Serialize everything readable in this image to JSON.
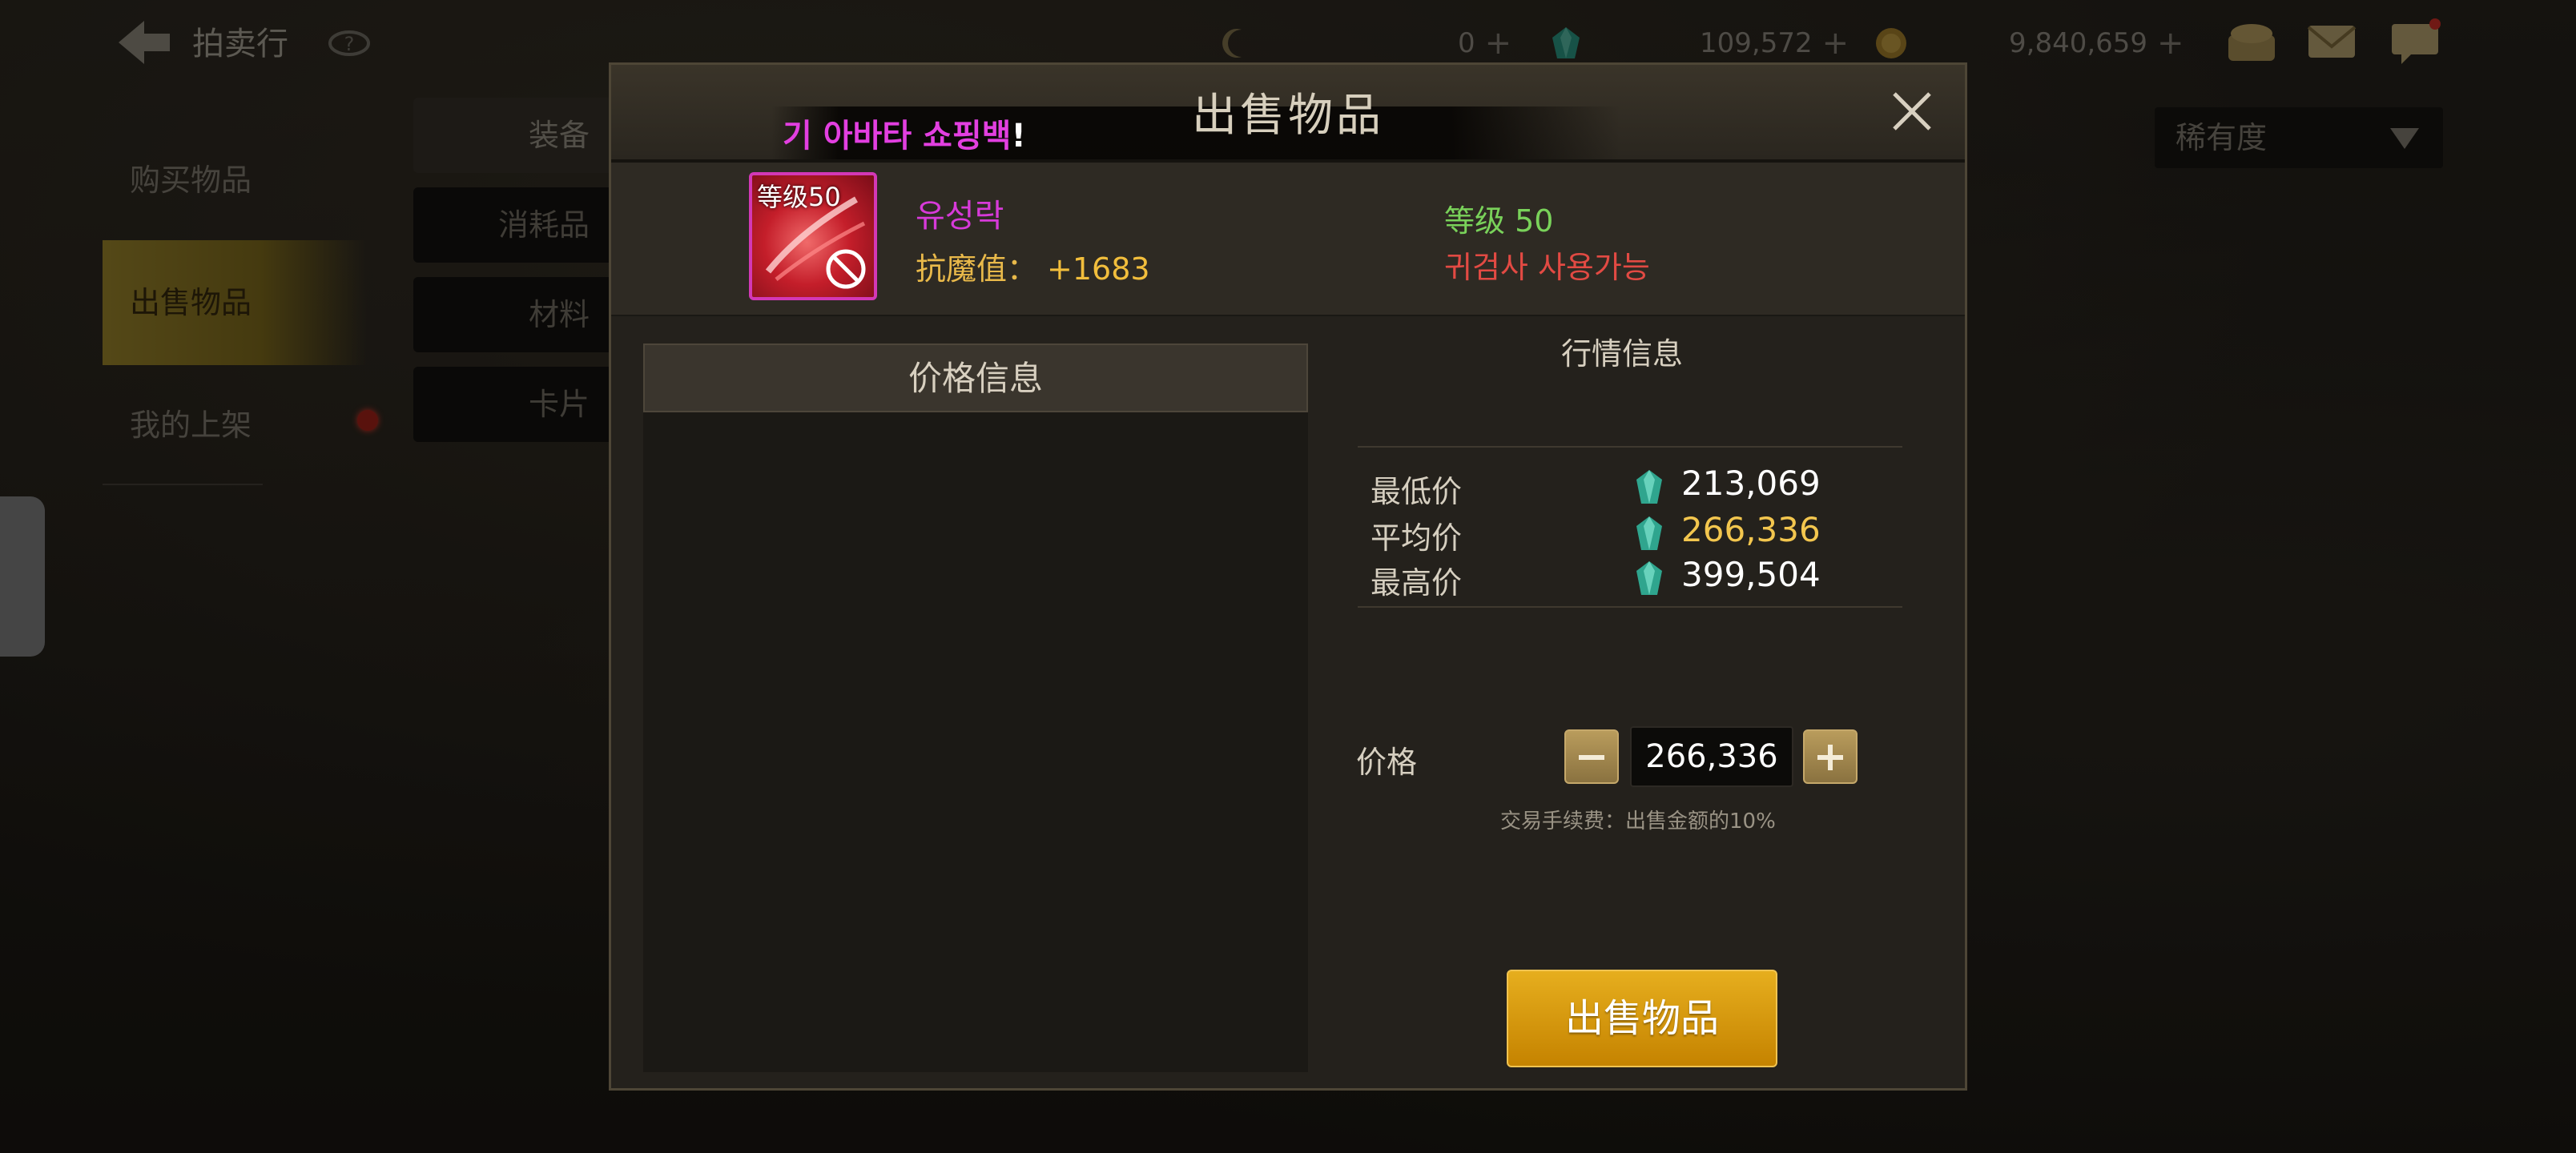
{
  "topbar": {
    "title": "拍卖行",
    "currencies": [
      {
        "name": "moon-token",
        "value": "0"
      },
      {
        "name": "gem",
        "value": "109,572"
      },
      {
        "name": "gold",
        "value": "9,840,659"
      }
    ]
  },
  "sidebar": {
    "items": [
      {
        "label": "购买物品"
      },
      {
        "label": "出售物品"
      },
      {
        "label": "我的上架"
      }
    ]
  },
  "tabs": [
    {
      "label": "装备"
    },
    {
      "label": "消耗品"
    },
    {
      "label": "材料"
    },
    {
      "label": "卡片"
    }
  ],
  "filter": {
    "selected": "稀有度"
  },
  "modal": {
    "title": "出售物品",
    "notice": "기 아바타 쇼핑백",
    "notice_bang": "!",
    "item": {
      "level_badge": "等级50",
      "name": "유성락",
      "stat_label": "抗魔值：",
      "stat_value": "+1683",
      "req_level": "等级 50",
      "req_class": "귀검사 사용가능"
    },
    "price_info_header": "价格信息",
    "market": {
      "title": "行情信息",
      "rows": [
        {
          "label": "最低价",
          "value": "213,069"
        },
        {
          "label": "平均价",
          "value": "266,336"
        },
        {
          "label": "最高价",
          "value": "399,504"
        }
      ]
    },
    "price_label": "价格",
    "price_value": "266,336",
    "fee_note": "交易手续费：出售金额的10%",
    "sell_button": "出售物品"
  },
  "colors": {
    "accent_gold": "#c58300",
    "item_name": "#d73ad9",
    "req_level": "#79d25a",
    "req_class": "#e24a43",
    "avg_price": "#f3c64e"
  }
}
